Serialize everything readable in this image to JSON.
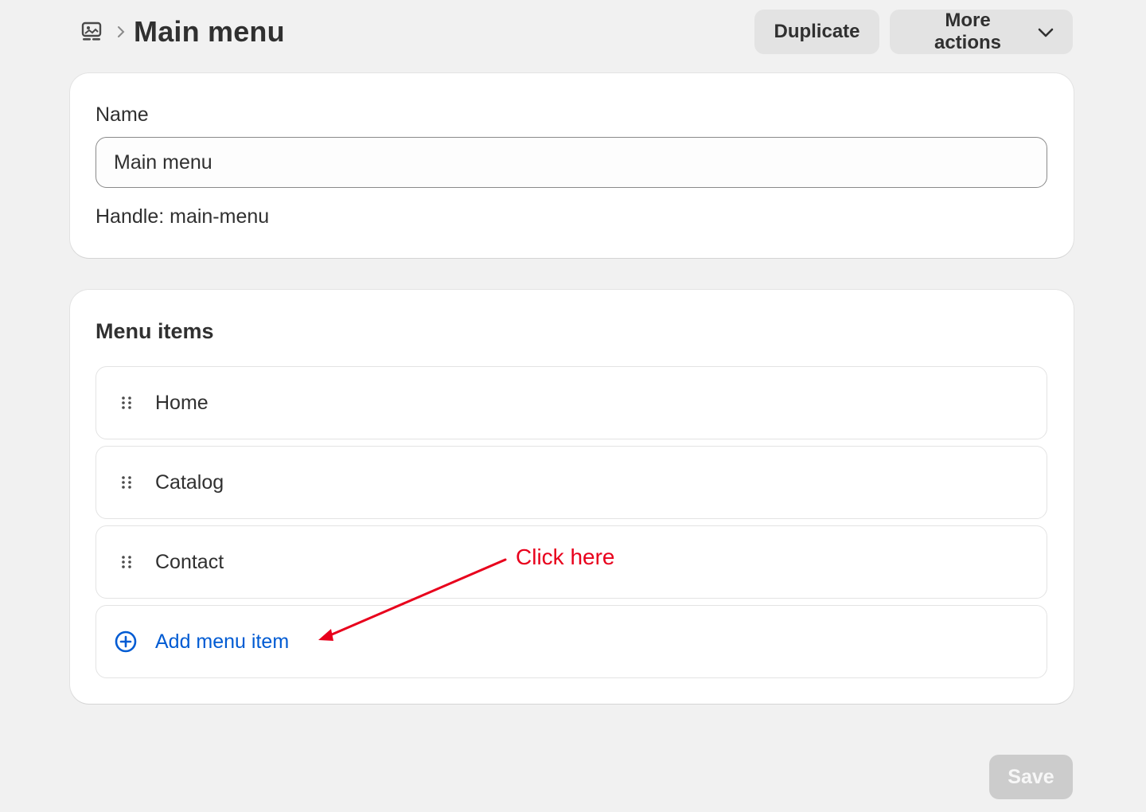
{
  "header": {
    "title": "Main menu",
    "breadcrumb_icon": "navigation-icon",
    "breadcrumb_separator": "›",
    "actions": {
      "duplicate_label": "Duplicate",
      "more_actions_label": "More actions"
    }
  },
  "name_card": {
    "label": "Name",
    "input_value": "Main menu",
    "handle_label": "Handle:",
    "handle_value": "main-menu"
  },
  "menu_items_card": {
    "title": "Menu items",
    "items": [
      {
        "label": "Home"
      },
      {
        "label": "Catalog"
      },
      {
        "label": "Contact"
      }
    ],
    "add_label": "Add menu item"
  },
  "annotation": {
    "text": "Click here",
    "color": "#e8001c"
  },
  "footer": {
    "save_label": "Save"
  },
  "colors": {
    "background": "#f1f1f1",
    "link": "#005bd3",
    "save_disabled": "#cccccc"
  }
}
